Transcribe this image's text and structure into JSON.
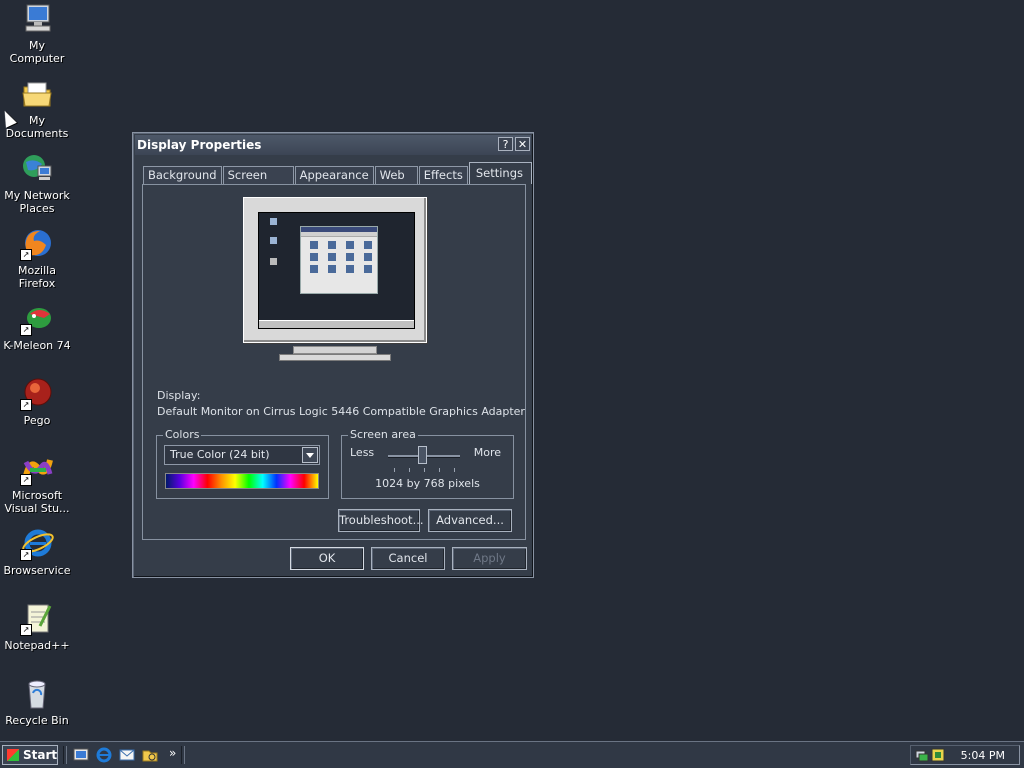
{
  "desktop": {
    "icons": [
      {
        "label": "My Computer"
      },
      {
        "label": "My Documents"
      },
      {
        "label": "My Network Places"
      },
      {
        "label": "Mozilla Firefox"
      },
      {
        "label": "K-Meleon 74"
      },
      {
        "label": "Pego"
      },
      {
        "label": "Microsoft Visual Stu..."
      },
      {
        "label": "Browservice"
      },
      {
        "label": "Notepad++"
      },
      {
        "label": "Recycle Bin"
      }
    ]
  },
  "dialog": {
    "title": "Display Properties",
    "help_button": "?",
    "close_button": "✕",
    "tabs": [
      {
        "label": "Background"
      },
      {
        "label": "Screen Saver"
      },
      {
        "label": "Appearance"
      },
      {
        "label": "Web"
      },
      {
        "label": "Effects"
      },
      {
        "label": "Settings",
        "active": true
      }
    ],
    "settings": {
      "display_label": "Display:",
      "display_value": "Default Monitor on Cirrus Logic 5446 Compatible Graphics Adapter",
      "colors_group": "Colors",
      "colors_selected": "True Color (24 bit)",
      "screen_area_group": "Screen area",
      "less_label": "Less",
      "more_label": "More",
      "resolution": "1024 by 768 pixels",
      "troubleshoot_button": "Troubleshoot...",
      "advanced_button": "Advanced..."
    },
    "ok_button": "OK",
    "cancel_button": "Cancel",
    "apply_button": "Apply"
  },
  "taskbar": {
    "start_label": "Start",
    "chevron": "»",
    "clock": "5:04 PM"
  },
  "colors": {
    "desktop": "#252b36",
    "dialog": "#353d49",
    "accent": "#4d5869"
  }
}
